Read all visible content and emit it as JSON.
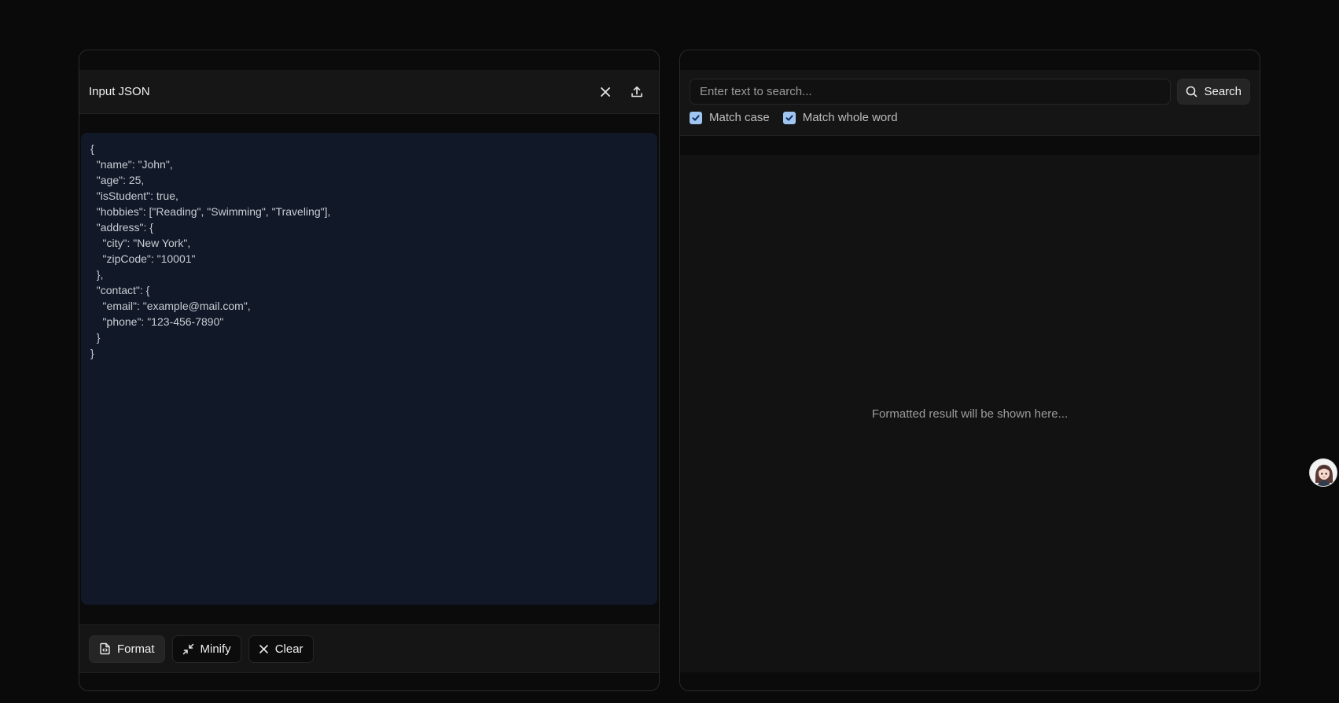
{
  "input_panel": {
    "title": "Input JSON",
    "icons": {
      "close": "close-icon",
      "upload": "upload-icon"
    },
    "editor_lines": [
      "{",
      "  \"name\": \"John\",",
      "  \"age\": 25,",
      "  \"isStudent\": true,",
      "  \"hobbies\": [\"Reading\", \"Swimming\", \"Traveling\"],",
      "  \"address\": {",
      "    \"city\": \"New York\",",
      "    \"zipCode\": \"10001\"",
      "  },",
      "  \"contact\": {",
      "    \"email\": \"example@mail.com\",",
      "    \"phone\": \"123-456-7890\"",
      "  }",
      "}"
    ],
    "buttons": {
      "format": "Format",
      "minify": "Minify",
      "clear": "Clear"
    }
  },
  "result_panel": {
    "search": {
      "placeholder": "Enter text to search...",
      "value": "",
      "button_label": "Search"
    },
    "options": {
      "match_case": {
        "label": "Match case",
        "checked": true
      },
      "match_whole_word": {
        "label": "Match whole word",
        "checked": true
      }
    },
    "empty_message": "Formatted result will be shown here..."
  },
  "colors": {
    "background": "#0a0a0a",
    "editor_bg": "#111827",
    "checkbox_accent": "#9fc5f0"
  }
}
